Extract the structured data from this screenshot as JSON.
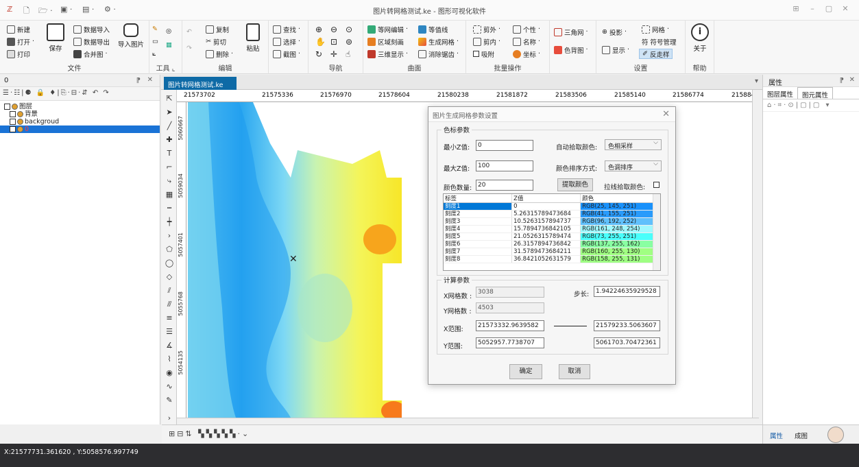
{
  "titlebar": {
    "title": "图片转网格测试.ke - 图形可视化软件",
    "min": "–",
    "restore": "▢",
    "close": "✕",
    "help": "⊞"
  },
  "ribbon": {
    "file": {
      "label": "文件",
      "new": "新建",
      "open": "打开",
      "print": "打印",
      "save": "保存",
      "import_data": "数据导入",
      "export_data": "数据导出",
      "merge": "合并图",
      "import_image": "导入图片"
    },
    "tools": {
      "label": "工具"
    },
    "edit": {
      "label": "编辑",
      "copy": "复制",
      "cut": "剪切",
      "delete": "删除",
      "paste": "粘贴",
      "find": "查找",
      "select": "选择",
      "crop": "截图"
    },
    "nav": {
      "label": "导航"
    },
    "surface": {
      "label": "曲面",
      "contour_edit": "等网编辑",
      "region_fill": "区域刻画",
      "three_view": "三维显示",
      "contour_line": "等值线",
      "gen_grid": "生成网格",
      "clear_smooth": "消除锯齿"
    },
    "batch": {
      "label": "批量操作",
      "cut_out": "剪外",
      "cut_in": "剪内",
      "snap": "吸附",
      "style": "个性",
      "name": "名称",
      "coord": "坐标"
    },
    "triangle": {
      "tri_net": "三角网",
      "bg_color": "色背图"
    },
    "settings": {
      "label": "设置",
      "projection": "投影",
      "display": "显示",
      "grid": "网格",
      "symbol_mgr": "符号管理",
      "antialias": "反走样"
    },
    "help": {
      "label": "帮助",
      "about": "关于"
    }
  },
  "layer_panel": {
    "header": "0",
    "items": [
      {
        "label": "图层"
      },
      {
        "label": "背景"
      },
      {
        "label": "backgroud"
      },
      {
        "label": "0"
      }
    ]
  },
  "document": {
    "tab": "图片转网格测试.ke",
    "ruler_ticks": [
      "21573702",
      "21575336",
      "21576970",
      "21578604",
      "21580238",
      "21581872",
      "21583506",
      "21585140",
      "21586774",
      "215884"
    ],
    "vruler_ticks": [
      "5060667",
      "5059034",
      "5057401",
      "5055768",
      "5054135"
    ]
  },
  "right_panel": {
    "header": "属性",
    "tab_layer": "图层属性",
    "tab_element": "图元属性",
    "bottom_tab1": "属性",
    "bottom_tab2": "成图"
  },
  "status": {
    "coords": "X:21577731.361620 , Y:5058576.997749"
  },
  "dialog": {
    "title": "图片生成网格参数设置",
    "color_group": "色标参数",
    "min_label": "最小Z值:",
    "min_value": "0",
    "max_label": "最大Z值:",
    "max_value": "100",
    "count_label": "颜色数量:",
    "count_value": "20",
    "auto_pick_label": "自动拾取颜色:",
    "auto_pick_value": "色相采样",
    "sort_label": "颜色排序方式:",
    "sort_value": "色调排序",
    "extract_btn": "提取颜色",
    "line_pick_label": "拉线拾取颜色:",
    "table_headers": [
      "标签",
      "Z值",
      "颜色"
    ],
    "table_rows": [
      {
        "label": "刻度1",
        "z": "0",
        "color": "RGB(25, 145, 251)",
        "hex": "#1991fb"
      },
      {
        "label": "刻度2",
        "z": "5.26315789473684",
        "color": "RGB(41, 155, 251)",
        "hex": "#299bfb"
      },
      {
        "label": "刻度3",
        "z": "10.5263157894737",
        "color": "RGB(96, 192, 252)",
        "hex": "#60c0fc"
      },
      {
        "label": "刻度4",
        "z": "15.7894736842105",
        "color": "RGB(161, 248, 254)",
        "hex": "#a1f8fe"
      },
      {
        "label": "刻度5",
        "z": "21.0526315789474",
        "color": "RGB(73, 255, 251)",
        "hex": "#49fffb"
      },
      {
        "label": "刻度6",
        "z": "26.3157894736842",
        "color": "RGB(137, 255, 162)",
        "hex": "#89ffa2"
      },
      {
        "label": "刻度7",
        "z": "31.5789473684211",
        "color": "RGB(160, 255, 130)",
        "hex": "#a0ff82"
      },
      {
        "label": "刻度8",
        "z": "36.8421052631579",
        "color": "RGB(158, 255, 131)",
        "hex": "#9eff83"
      }
    ],
    "calc_group": "计算参数",
    "xgrid_label": "X网格数 :",
    "xgrid_value": "3038",
    "ygrid_label": "Y网格数 :",
    "ygrid_value": "4503",
    "step_label": "步长:",
    "step_value": "1.94224635929528",
    "xrange_label": "X范围:",
    "xmin_value": "21573332.9639582",
    "xmax_value": "21579233.5063607",
    "yrange_label": "Y范围:",
    "ymin_value": "5052957.7738707",
    "ymax_value": "5061703.70472361",
    "ok_btn": "确定",
    "cancel_btn": "取消"
  }
}
